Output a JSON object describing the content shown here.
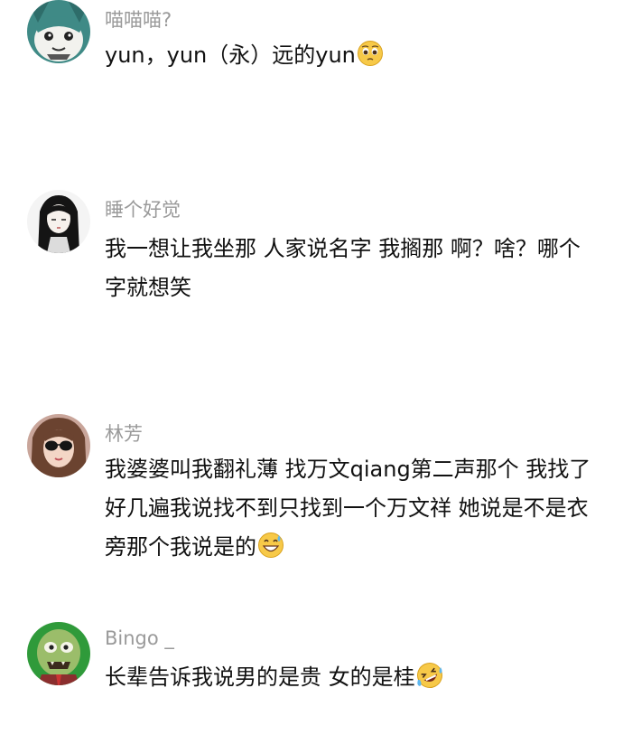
{
  "comments": [
    {
      "username": "喵喵喵?",
      "avatar_icon": "cartoon-cat-avatar",
      "text": "yun，yun（永）远的yun",
      "emoji": "pleading-face-emoji"
    },
    {
      "username": "睡个好觉",
      "avatar_icon": "anime-girl-avatar",
      "text": "我一想让我坐那 人家说名字 我搁那 啊？啥？哪个字就想笑",
      "emoji": ""
    },
    {
      "username": "林芳",
      "avatar_icon": "girl-sunglasses-avatar",
      "text": "我婆婆叫我翻礼薄   找万文qiang第二声那个  我找了好几遍我说找不到只找到一个万文祥  她说是不是衣旁那个我说是的",
      "emoji": "grinning-sweat-emoji"
    },
    {
      "username": "Bingo _",
      "avatar_icon": "zombie-avatar",
      "text": "长辈告诉我说男的是贵 女的是桂",
      "emoji": "rolling-laughing-emoji"
    }
  ],
  "colors": {
    "username": "#9a9a9a",
    "text": "#111111",
    "background": "#ffffff"
  }
}
